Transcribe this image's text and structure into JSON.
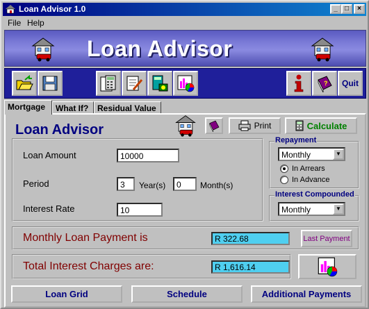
{
  "window": {
    "title": "Loan Advisor 1.0",
    "controls": {
      "minimize": "_",
      "maximize": "□",
      "close": "×"
    }
  },
  "menu": {
    "items": [
      {
        "label": "File"
      },
      {
        "label": "Help"
      }
    ]
  },
  "banner": {
    "title": "Loan Advisor"
  },
  "toolbar": {
    "items": [
      {
        "icon": "open-folder-icon"
      },
      {
        "icon": "save-disk-icon"
      },
      {
        "icon": "calculator-sheet-icon"
      },
      {
        "icon": "notepad-edit-icon"
      },
      {
        "icon": "calculator-money-icon"
      },
      {
        "icon": "chart-icon"
      },
      {
        "icon": "info-icon"
      },
      {
        "icon": "help-book-icon"
      }
    ],
    "quit_label": "Quit"
  },
  "tabs": [
    {
      "label": "Mortgage",
      "active": true
    },
    {
      "label": "What If?",
      "active": false
    },
    {
      "label": "Residual Value",
      "active": false
    }
  ],
  "main": {
    "heading": "Loan Advisor",
    "print_label": "Print",
    "calculate_label": "Calculate"
  },
  "form": {
    "loan_amount_label": "Loan Amount",
    "loan_amount_value": "10000",
    "period_label": "Period",
    "period_years_value": "3",
    "years_unit": "Year(s)",
    "period_months_value": "0",
    "months_unit": "Month(s)",
    "interest_rate_label": "Interest Rate",
    "interest_rate_value": "10"
  },
  "repayment": {
    "title": "Repayment",
    "frequency": "Monthly",
    "options": [
      {
        "label": "In Arrears",
        "selected": true
      },
      {
        "label": "In Advance",
        "selected": false
      }
    ]
  },
  "interest_compounded": {
    "title": "Interest Compounded",
    "frequency": "Monthly"
  },
  "results": {
    "monthly_label": "Monthly Loan Payment is",
    "monthly_value": "R 322.68",
    "last_payment_label": "Last Payment",
    "total_interest_label": "Total Interest Charges are:",
    "total_interest_value": "R 1,616.14"
  },
  "bottom_nav": {
    "loan_grid": "Loan Grid",
    "schedule": "Schedule",
    "additional_payments": "Additional Payments"
  },
  "colors": {
    "title_bar": "#000080",
    "banner": "#7c7cd8",
    "toolbar": "#1f1f9a",
    "heading": "#000080",
    "result_text": "#800000",
    "result_field": "#4fcff0",
    "calculate_text": "#008000"
  }
}
